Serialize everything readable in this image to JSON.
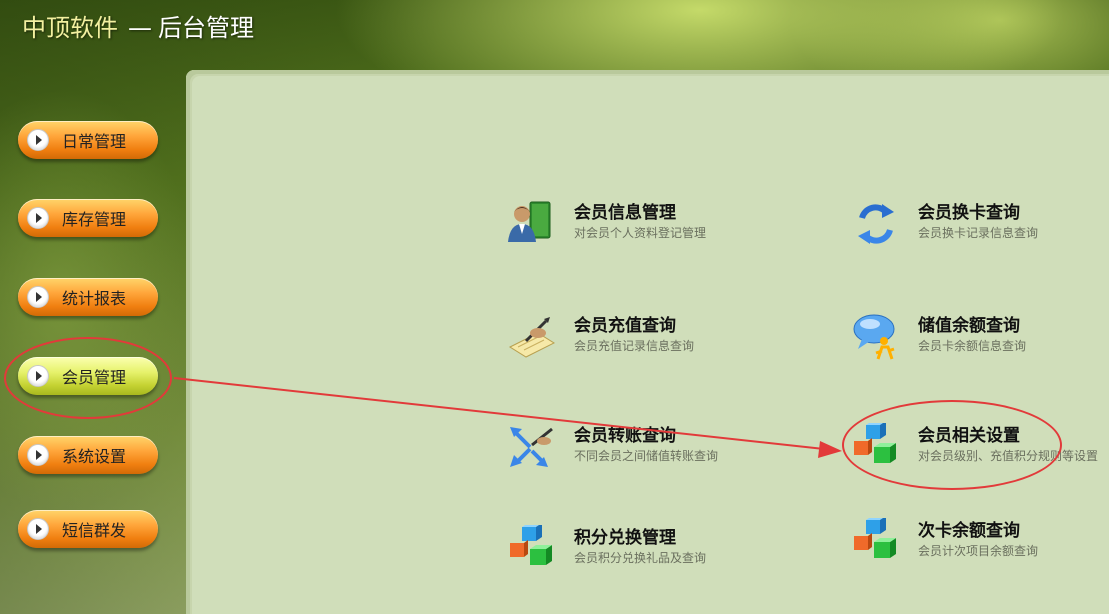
{
  "header": {
    "brand": "中顶软件",
    "separator": "—",
    "section": "后台管理"
  },
  "sidebar": {
    "items": [
      {
        "label": "日常管理"
      },
      {
        "label": "库存管理"
      },
      {
        "label": "统计报表"
      },
      {
        "label": "会员管理",
        "active": true
      },
      {
        "label": "系统设置"
      },
      {
        "label": "短信群发"
      }
    ]
  },
  "menu": [
    {
      "title": "会员信息管理",
      "desc": "对会员个人资料登记管理",
      "icon": "member-info-icon"
    },
    {
      "title": "会员换卡查询",
      "desc": "会员换卡记录信息查询",
      "icon": "refresh-icon"
    },
    {
      "title": "会员充值查询",
      "desc": "会员充值记录信息查询",
      "icon": "recharge-icon"
    },
    {
      "title": "储值余额查询",
      "desc": "会员卡余额信息查询",
      "icon": "balance-icon"
    },
    {
      "title": "会员转账查询",
      "desc": "不同会员之间储值转账查询",
      "icon": "transfer-icon"
    },
    {
      "title": "会员相关设置",
      "desc": "对会员级别、充值积分规则等设置",
      "icon": "cubes-icon"
    },
    {
      "title": "积分兑换管理",
      "desc": "会员积分兑换礼品及查询",
      "icon": "cubes-icon"
    },
    {
      "title": "次卡余额查询",
      "desc": "会员计次项目余额查询",
      "icon": "cubes-icon"
    }
  ],
  "colors": {
    "content_bg": "#d0deba",
    "nav_orange": "#f07f10",
    "nav_active": "#c4d232",
    "annotation_red": "#e23a3a"
  }
}
